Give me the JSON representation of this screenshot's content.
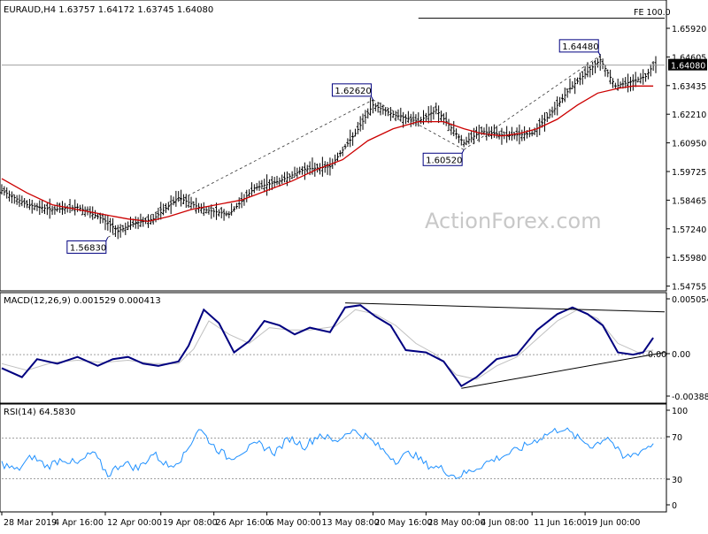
{
  "chart_data": {
    "type": "line",
    "symbol_line": "EURAUD,H4  1.63757 1.64172 1.63745 1.64080",
    "watermark": "ActionForex.com",
    "colors": {
      "candles": "#000000",
      "ma": "#cc0000",
      "macd": "#000080",
      "macd_signal": "#c0c0c0",
      "rsi": "#1e90ff",
      "grid": "#a0a0a0",
      "annotation": "#000080"
    },
    "price": {
      "ylim": [
        1.5465,
        1.6615
      ],
      "y_ticks": [
        "1.65920",
        "1.64605",
        "1.63435",
        "1.62210",
        "1.60950",
        "1.59725",
        "1.58465",
        "1.57240",
        "1.55980",
        "1.54755"
      ],
      "last_price_label": "1.64080",
      "fe_label": "FE 100.0",
      "fe_level": 1.6605,
      "annotations": [
        {
          "label": "1.56830",
          "value": 1.5683,
          "bar": 42
        },
        {
          "label": "1.62620",
          "value": 1.6262,
          "bar": 147
        },
        {
          "label": "1.60520",
          "value": 1.6052,
          "bar": 183
        },
        {
          "label": "1.64480",
          "value": 1.6448,
          "bar": 237
        }
      ],
      "close_path": [
        [
          0,
          1.588
        ],
        [
          10,
          1.582
        ],
        [
          20,
          1.58
        ],
        [
          30,
          1.581
        ],
        [
          40,
          1.576
        ],
        [
          46,
          1.571
        ],
        [
          52,
          1.574
        ],
        [
          60,
          1.576
        ],
        [
          70,
          1.585
        ],
        [
          80,
          1.58
        ],
        [
          90,
          1.578
        ],
        [
          100,
          1.589
        ],
        [
          110,
          1.592
        ],
        [
          120,
          1.597
        ],
        [
          130,
          1.598
        ],
        [
          140,
          1.612
        ],
        [
          147,
          1.624
        ],
        [
          155,
          1.62
        ],
        [
          165,
          1.617
        ],
        [
          172,
          1.622
        ],
        [
          183,
          1.608
        ],
        [
          190,
          1.613
        ],
        [
          200,
          1.611
        ],
        [
          210,
          1.612
        ],
        [
          218,
          1.621
        ],
        [
          225,
          1.631
        ],
        [
          232,
          1.638
        ],
        [
          237,
          1.643
        ],
        [
          243,
          1.632
        ],
        [
          250,
          1.634
        ],
        [
          255,
          1.636
        ],
        [
          258,
          1.6408
        ]
      ],
      "ma_path": [
        [
          0,
          1.593
        ],
        [
          10,
          1.587
        ],
        [
          20,
          1.582
        ],
        [
          30,
          1.58
        ],
        [
          40,
          1.578
        ],
        [
          50,
          1.576
        ],
        [
          58,
          1.575
        ],
        [
          66,
          1.577
        ],
        [
          75,
          1.58
        ],
        [
          85,
          1.582
        ],
        [
          95,
          1.584
        ],
        [
          105,
          1.588
        ],
        [
          115,
          1.592
        ],
        [
          125,
          1.597
        ],
        [
          135,
          1.601
        ],
        [
          145,
          1.609
        ],
        [
          155,
          1.614
        ],
        [
          165,
          1.617
        ],
        [
          175,
          1.617
        ],
        [
          183,
          1.614
        ],
        [
          190,
          1.612
        ],
        [
          198,
          1.611
        ],
        [
          205,
          1.612
        ],
        [
          212,
          1.614
        ],
        [
          220,
          1.618
        ],
        [
          228,
          1.624
        ],
        [
          236,
          1.629
        ],
        [
          244,
          1.631
        ],
        [
          250,
          1.632
        ],
        [
          258,
          1.632
        ]
      ]
    },
    "macd": {
      "label": "MACD(12,26,9) 0.001529 0.000413",
      "ylim": [
        -0.004,
        0.0052
      ],
      "y_ticks": [
        "0.005054",
        "0.00",
        "0.00",
        "-0.003883"
      ],
      "main_path": [
        [
          0,
          -0.0012
        ],
        [
          8,
          -0.002
        ],
        [
          14,
          -0.0004
        ],
        [
          22,
          -0.0008
        ],
        [
          30,
          -0.0002
        ],
        [
          38,
          -0.001
        ],
        [
          44,
          -0.0004
        ],
        [
          50,
          -0.0002
        ],
        [
          56,
          -0.0008
        ],
        [
          62,
          -0.001
        ],
        [
          70,
          -0.0006
        ],
        [
          74,
          0.0008
        ],
        [
          80,
          0.004
        ],
        [
          86,
          0.0028
        ],
        [
          92,
          0.0002
        ],
        [
          98,
          0.0012
        ],
        [
          104,
          0.003
        ],
        [
          110,
          0.0026
        ],
        [
          116,
          0.0018
        ],
        [
          122,
          0.0024
        ],
        [
          130,
          0.002
        ],
        [
          136,
          0.0042
        ],
        [
          142,
          0.0044
        ],
        [
          148,
          0.0034
        ],
        [
          154,
          0.0026
        ],
        [
          160,
          0.0004
        ],
        [
          168,
          0.0002
        ],
        [
          175,
          -0.0006
        ],
        [
          182,
          -0.0028
        ],
        [
          188,
          -0.002
        ],
        [
          196,
          -0.0004
        ],
        [
          204,
          0.0
        ],
        [
          212,
          0.0022
        ],
        [
          220,
          0.0036
        ],
        [
          226,
          0.0042
        ],
        [
          232,
          0.0036
        ],
        [
          238,
          0.0026
        ],
        [
          244,
          0.0002
        ],
        [
          250,
          0.0
        ],
        [
          254,
          0.0002
        ],
        [
          258,
          0.0015
        ]
      ],
      "signal_path": [
        [
          0,
          -0.0008
        ],
        [
          10,
          -0.0014
        ],
        [
          20,
          -0.0007
        ],
        [
          30,
          -0.0005
        ],
        [
          40,
          -0.0007
        ],
        [
          50,
          -0.0005
        ],
        [
          60,
          -0.0008
        ],
        [
          70,
          -0.0008
        ],
        [
          76,
          0.0005
        ],
        [
          82,
          0.003
        ],
        [
          90,
          0.0018
        ],
        [
          98,
          0.001
        ],
        [
          106,
          0.0024
        ],
        [
          114,
          0.0022
        ],
        [
          122,
          0.0022
        ],
        [
          132,
          0.0025
        ],
        [
          140,
          0.004
        ],
        [
          148,
          0.0036
        ],
        [
          156,
          0.0026
        ],
        [
          164,
          0.001
        ],
        [
          172,
          0.0
        ],
        [
          180,
          -0.0018
        ],
        [
          188,
          -0.0022
        ],
        [
          196,
          -0.001
        ],
        [
          204,
          -0.0002
        ],
        [
          212,
          0.0014
        ],
        [
          220,
          0.003
        ],
        [
          228,
          0.004
        ],
        [
          236,
          0.0032
        ],
        [
          244,
          0.001
        ],
        [
          252,
          0.0002
        ],
        [
          258,
          0.0004
        ]
      ]
    },
    "rsi": {
      "label": "RSI(14) 64.5830",
      "ylim": [
        0,
        100
      ],
      "y_ticks": [
        "100",
        "70",
        "30",
        "0"
      ],
      "levels": [
        70,
        30
      ],
      "path": [
        [
          0,
          45
        ],
        [
          6,
          38
        ],
        [
          12,
          52
        ],
        [
          18,
          42
        ],
        [
          24,
          50
        ],
        [
          30,
          44
        ],
        [
          36,
          56
        ],
        [
          42,
          34
        ],
        [
          48,
          46
        ],
        [
          54,
          40
        ],
        [
          60,
          55
        ],
        [
          66,
          42
        ],
        [
          72,
          52
        ],
        [
          78,
          80
        ],
        [
          84,
          62
        ],
        [
          90,
          50
        ],
        [
          96,
          58
        ],
        [
          102,
          64
        ],
        [
          108,
          56
        ],
        [
          114,
          70
        ],
        [
          120,
          62
        ],
        [
          126,
          74
        ],
        [
          132,
          66
        ],
        [
          138,
          78
        ],
        [
          144,
          72
        ],
        [
          150,
          60
        ],
        [
          156,
          48
        ],
        [
          162,
          56
        ],
        [
          168,
          44
        ],
        [
          174,
          40
        ],
        [
          180,
          32
        ],
        [
          186,
          38
        ],
        [
          192,
          46
        ],
        [
          198,
          52
        ],
        [
          204,
          58
        ],
        [
          210,
          66
        ],
        [
          216,
          74
        ],
        [
          222,
          80
        ],
        [
          228,
          70
        ],
        [
          234,
          62
        ],
        [
          240,
          72
        ],
        [
          246,
          50
        ],
        [
          252,
          56
        ],
        [
          258,
          64.583
        ]
      ]
    },
    "x_ticks": [
      {
        "label": "28 Mar 2019",
        "bar": 0
      },
      {
        "label": "4 Apr 16:00",
        "bar": 20
      },
      {
        "label": "12 Apr 00:00",
        "bar": 41
      },
      {
        "label": "19 Apr 08:00",
        "bar": 63
      },
      {
        "label": "26 Apr 16:00",
        "bar": 84
      },
      {
        "label": "6 May 00:00",
        "bar": 105
      },
      {
        "label": "13 May 08:00",
        "bar": 126
      },
      {
        "label": "20 May 16:00",
        "bar": 147
      },
      {
        "label": "28 May 00:00",
        "bar": 168
      },
      {
        "label": "4 Jun 08:00",
        "bar": 189
      },
      {
        "label": "11 Jun 16:00",
        "bar": 210
      },
      {
        "label": "19 Jun 00:00",
        "bar": 231
      }
    ],
    "bar_count": 260
  }
}
